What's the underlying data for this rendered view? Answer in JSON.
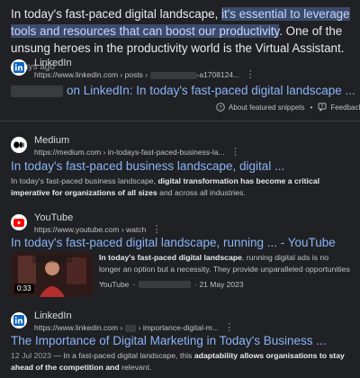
{
  "top_snippet": {
    "before": "In today's fast-paced digital landscape, ",
    "highlight": "it's essential to leverage tools and resources that can boost our productivity",
    "after": ". One of the unsung heroes in the productivity world is the Virtual Assistant.",
    "date": "3 days ago"
  },
  "result1": {
    "site": "LinkedIn",
    "url_prefix": "https://www.linkedin.com › posts ›",
    "url_suffix": "-a1708124...",
    "title": "on LinkedIn: In today's fast-paced digital landscape ..."
  },
  "feedback": {
    "about_label": "About featured snippets",
    "separator": "•",
    "feedback_label": "Feedback"
  },
  "result2": {
    "site": "Medium",
    "url": "https://medium.com › in-todays-fast-paced-business-la...",
    "title": "In today's fast-paced business landscape, digital ...",
    "desc_plain1": "In today's fast-paced business landscape, ",
    "desc_bold1": "digital transformation has become a critical imperative for organizations of all sizes",
    "desc_plain2": " and across all industries."
  },
  "result3": {
    "site": "YouTube",
    "url": "https://www.youtube.com › watch",
    "title": "In today's fast-paced digital landscape, running ... - YouTube",
    "desc_bold": "In today's fast-paced digital landscape",
    "desc_plain": ", running digital ads is no longer an option but a necessity. They provide unparalleled opportunities ...",
    "duration": "0:33",
    "meta_source": "YouTube",
    "meta_sep": "·",
    "meta_date": "· 21 May 2023"
  },
  "result4": {
    "site": "LinkedIn",
    "url_prefix": "https://www.linkedin.com › ",
    "url_suffix": "› importance-digital-m...",
    "title": "The Importance of Digital Marketing in Today's Business ...",
    "date": "12 Jul 2023",
    "desc_plain1": " — In a fast-paced digital landscape, this ",
    "desc_bold1": "adaptability allows organisations to stay ahead of the competition and",
    "desc_plain2": " relevant."
  },
  "colors": {
    "background": "#202124",
    "link": "#8ab4f8",
    "highlight": "#3c4a6b",
    "linkedin": "#0a66c2",
    "youtube": "#ff0000"
  },
  "icons": [
    "linkedin-icon",
    "medium-icon",
    "youtube-icon",
    "question-icon",
    "feedback-icon",
    "more-options-icon"
  ]
}
